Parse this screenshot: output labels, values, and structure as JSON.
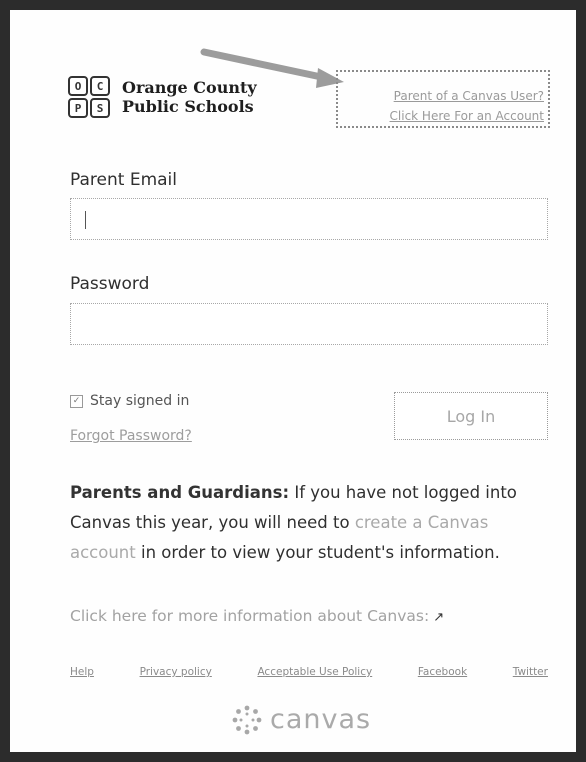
{
  "header": {
    "org_name_line1": "Orange County",
    "org_name_line2": "Public Schools",
    "logo_letters": [
      "O",
      "C",
      "P",
      "S"
    ],
    "parent_link_line1": "Parent of a Canvas User?",
    "parent_link_line2": "Click Here For an Account"
  },
  "form": {
    "email_label": "Parent Email",
    "email_value": "",
    "password_label": "Password",
    "password_value": "",
    "stay_signed_in": "Stay signed in",
    "forgot_password": "Forgot Password?",
    "login_button": "Log In"
  },
  "info": {
    "bold_prefix": "Parents and Guardians:",
    "text_part1": " If you have not logged into Canvas this year, you will need to ",
    "link_text": "create a Canvas account",
    "text_part2": " in order to view your student's information."
  },
  "more_info": "Click here for more information about Canvas:",
  "footer_links": [
    "Help",
    "Privacy policy",
    "Acceptable Use Policy",
    "Facebook",
    "Twitter"
  ],
  "brand": "canvas",
  "colors": {
    "link_gray": "#9d9d9d",
    "frame": "#2c2c2c"
  }
}
